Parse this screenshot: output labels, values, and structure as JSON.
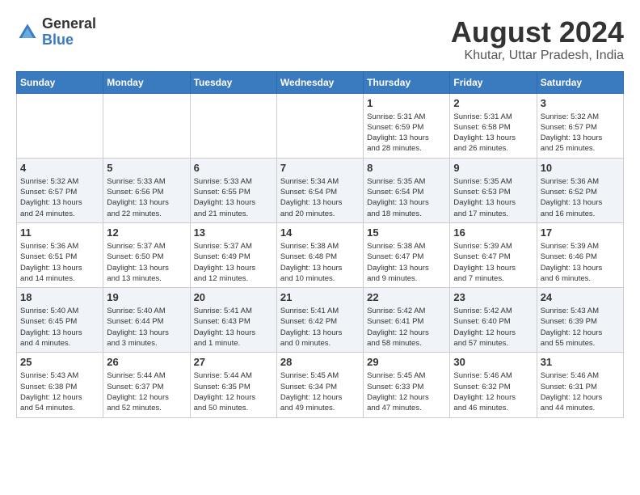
{
  "logo": {
    "general": "General",
    "blue": "Blue"
  },
  "title": {
    "month_year": "August 2024",
    "location": "Khutar, Uttar Pradesh, India"
  },
  "headers": [
    "Sunday",
    "Monday",
    "Tuesday",
    "Wednesday",
    "Thursday",
    "Friday",
    "Saturday"
  ],
  "weeks": [
    [
      {
        "day": "",
        "info": ""
      },
      {
        "day": "",
        "info": ""
      },
      {
        "day": "",
        "info": ""
      },
      {
        "day": "",
        "info": ""
      },
      {
        "day": "1",
        "info": "Sunrise: 5:31 AM\nSunset: 6:59 PM\nDaylight: 13 hours\nand 28 minutes."
      },
      {
        "day": "2",
        "info": "Sunrise: 5:31 AM\nSunset: 6:58 PM\nDaylight: 13 hours\nand 26 minutes."
      },
      {
        "day": "3",
        "info": "Sunrise: 5:32 AM\nSunset: 6:57 PM\nDaylight: 13 hours\nand 25 minutes."
      }
    ],
    [
      {
        "day": "4",
        "info": "Sunrise: 5:32 AM\nSunset: 6:57 PM\nDaylight: 13 hours\nand 24 minutes."
      },
      {
        "day": "5",
        "info": "Sunrise: 5:33 AM\nSunset: 6:56 PM\nDaylight: 13 hours\nand 22 minutes."
      },
      {
        "day": "6",
        "info": "Sunrise: 5:33 AM\nSunset: 6:55 PM\nDaylight: 13 hours\nand 21 minutes."
      },
      {
        "day": "7",
        "info": "Sunrise: 5:34 AM\nSunset: 6:54 PM\nDaylight: 13 hours\nand 20 minutes."
      },
      {
        "day": "8",
        "info": "Sunrise: 5:35 AM\nSunset: 6:54 PM\nDaylight: 13 hours\nand 18 minutes."
      },
      {
        "day": "9",
        "info": "Sunrise: 5:35 AM\nSunset: 6:53 PM\nDaylight: 13 hours\nand 17 minutes."
      },
      {
        "day": "10",
        "info": "Sunrise: 5:36 AM\nSunset: 6:52 PM\nDaylight: 13 hours\nand 16 minutes."
      }
    ],
    [
      {
        "day": "11",
        "info": "Sunrise: 5:36 AM\nSunset: 6:51 PM\nDaylight: 13 hours\nand 14 minutes."
      },
      {
        "day": "12",
        "info": "Sunrise: 5:37 AM\nSunset: 6:50 PM\nDaylight: 13 hours\nand 13 minutes."
      },
      {
        "day": "13",
        "info": "Sunrise: 5:37 AM\nSunset: 6:49 PM\nDaylight: 13 hours\nand 12 minutes."
      },
      {
        "day": "14",
        "info": "Sunrise: 5:38 AM\nSunset: 6:48 PM\nDaylight: 13 hours\nand 10 minutes."
      },
      {
        "day": "15",
        "info": "Sunrise: 5:38 AM\nSunset: 6:47 PM\nDaylight: 13 hours\nand 9 minutes."
      },
      {
        "day": "16",
        "info": "Sunrise: 5:39 AM\nSunset: 6:47 PM\nDaylight: 13 hours\nand 7 minutes."
      },
      {
        "day": "17",
        "info": "Sunrise: 5:39 AM\nSunset: 6:46 PM\nDaylight: 13 hours\nand 6 minutes."
      }
    ],
    [
      {
        "day": "18",
        "info": "Sunrise: 5:40 AM\nSunset: 6:45 PM\nDaylight: 13 hours\nand 4 minutes."
      },
      {
        "day": "19",
        "info": "Sunrise: 5:40 AM\nSunset: 6:44 PM\nDaylight: 13 hours\nand 3 minutes."
      },
      {
        "day": "20",
        "info": "Sunrise: 5:41 AM\nSunset: 6:43 PM\nDaylight: 13 hours\nand 1 minute."
      },
      {
        "day": "21",
        "info": "Sunrise: 5:41 AM\nSunset: 6:42 PM\nDaylight: 13 hours\nand 0 minutes."
      },
      {
        "day": "22",
        "info": "Sunrise: 5:42 AM\nSunset: 6:41 PM\nDaylight: 12 hours\nand 58 minutes."
      },
      {
        "day": "23",
        "info": "Sunrise: 5:42 AM\nSunset: 6:40 PM\nDaylight: 12 hours\nand 57 minutes."
      },
      {
        "day": "24",
        "info": "Sunrise: 5:43 AM\nSunset: 6:39 PM\nDaylight: 12 hours\nand 55 minutes."
      }
    ],
    [
      {
        "day": "25",
        "info": "Sunrise: 5:43 AM\nSunset: 6:38 PM\nDaylight: 12 hours\nand 54 minutes."
      },
      {
        "day": "26",
        "info": "Sunrise: 5:44 AM\nSunset: 6:37 PM\nDaylight: 12 hours\nand 52 minutes."
      },
      {
        "day": "27",
        "info": "Sunrise: 5:44 AM\nSunset: 6:35 PM\nDaylight: 12 hours\nand 50 minutes."
      },
      {
        "day": "28",
        "info": "Sunrise: 5:45 AM\nSunset: 6:34 PM\nDaylight: 12 hours\nand 49 minutes."
      },
      {
        "day": "29",
        "info": "Sunrise: 5:45 AM\nSunset: 6:33 PM\nDaylight: 12 hours\nand 47 minutes."
      },
      {
        "day": "30",
        "info": "Sunrise: 5:46 AM\nSunset: 6:32 PM\nDaylight: 12 hours\nand 46 minutes."
      },
      {
        "day": "31",
        "info": "Sunrise: 5:46 AM\nSunset: 6:31 PM\nDaylight: 12 hours\nand 44 minutes."
      }
    ]
  ]
}
